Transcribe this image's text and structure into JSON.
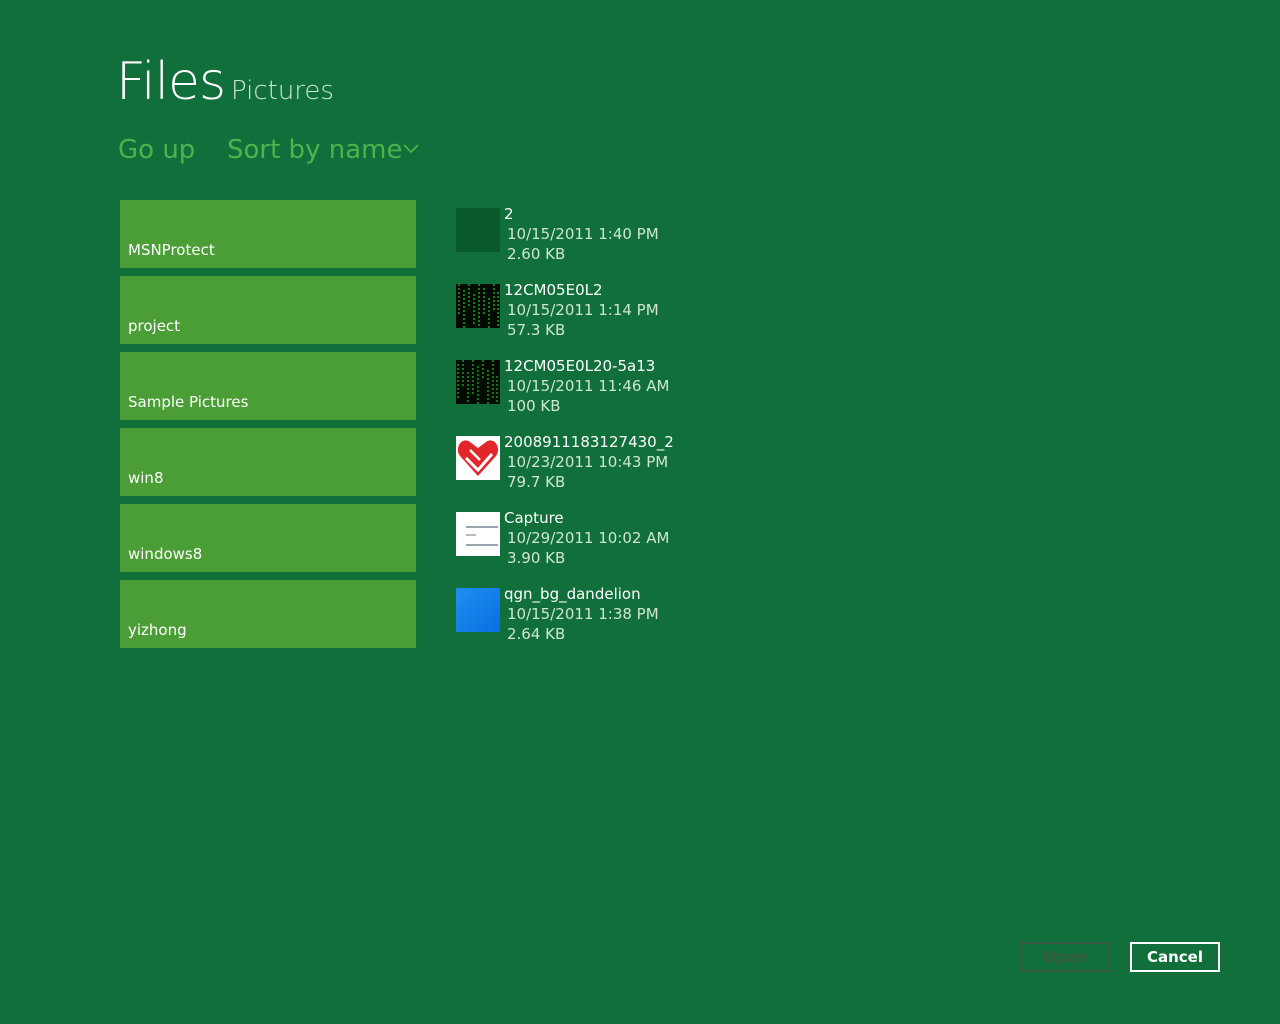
{
  "header": {
    "title": "Files",
    "location": "Pictures"
  },
  "commands": {
    "go_up": "Go up",
    "sort": "Sort by name"
  },
  "folders": [
    {
      "label": "MSNProtect"
    },
    {
      "label": "project"
    },
    {
      "label": "Sample Pictures"
    },
    {
      "label": "win8"
    },
    {
      "label": "windows8"
    },
    {
      "label": "yizhong"
    }
  ],
  "files": [
    {
      "name": "2",
      "date": "10/15/2011 1:40 PM",
      "size": "2.60 KB",
      "thumb": "dark-green-square"
    },
    {
      "name": "12CM05E0L2",
      "date": "10/15/2011 1:14 PM",
      "size": "57.3 KB",
      "thumb": "matrix-rain"
    },
    {
      "name": "12CM05E0L20-5a13",
      "date": "10/15/2011 11:46 AM",
      "size": "100 KB",
      "thumb": "matrix-rain"
    },
    {
      "name": "2008911183127430_2",
      "date": "10/23/2011 10:43 PM",
      "size": "79.7 KB",
      "thumb": "red-heart-logo"
    },
    {
      "name": "Capture",
      "date": "10/29/2011 10:02 AM",
      "size": "3.90 KB",
      "thumb": "screenshot-capture"
    },
    {
      "name": "qgn_bg_dandelion",
      "date": "10/15/2011 1:38 PM",
      "size": "2.64 KB",
      "thumb": "blue-square"
    }
  ],
  "footer": {
    "open_label": "Open",
    "cancel_label": "Cancel"
  },
  "colors": {
    "background": "#106f3a",
    "tile": "#4a9e35",
    "accent_text": "#4fb34c",
    "disabled": "#3c5a46"
  }
}
